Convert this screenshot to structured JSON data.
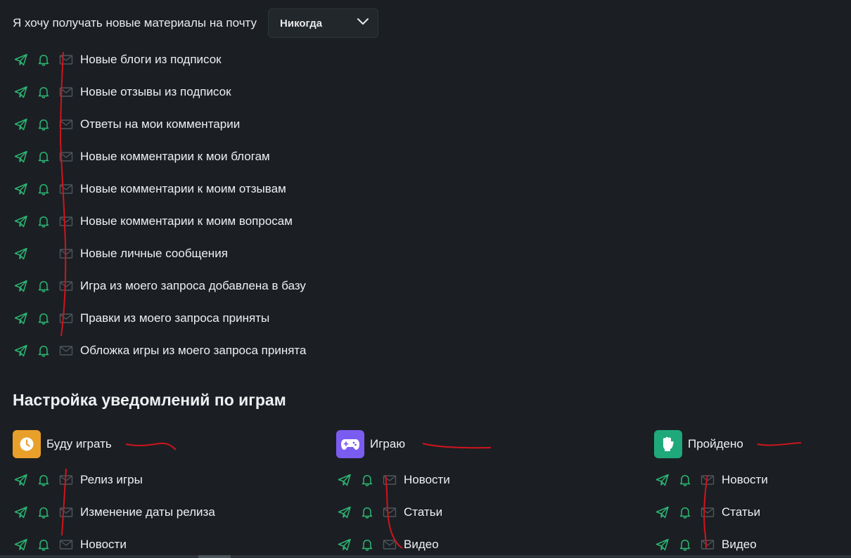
{
  "digest": {
    "label": "Я хочу получать новые материалы на почту",
    "selected": "Никогда"
  },
  "notifications": [
    {
      "label": "Новые блоги из подписок",
      "telegram": true,
      "bell": true,
      "email": true
    },
    {
      "label": "Новые отзывы из подписок",
      "telegram": true,
      "bell": true,
      "email": true
    },
    {
      "label": "Ответы на мои комментарии",
      "telegram": true,
      "bell": true,
      "email": true
    },
    {
      "label": "Новые комментарии к мои блогам",
      "telegram": true,
      "bell": true,
      "email": true
    },
    {
      "label": "Новые комментарии к моим отзывам",
      "telegram": true,
      "bell": true,
      "email": true
    },
    {
      "label": "Новые комментарии к моим вопросам",
      "telegram": true,
      "bell": true,
      "email": true
    },
    {
      "label": "Новые личные сообщения",
      "telegram": true,
      "bell": false,
      "email": true
    },
    {
      "label": "Игра из моего запроса добавлена в базу",
      "telegram": true,
      "bell": true,
      "email": true
    },
    {
      "label": "Правки из моего запроса приняты",
      "telegram": true,
      "bell": true,
      "email": true
    },
    {
      "label": "Обложка игры из моего запроса принята",
      "telegram": true,
      "bell": true,
      "email": true
    }
  ],
  "games_section": {
    "title": "Настройка уведомлений по играм",
    "categories": [
      {
        "title": "Буду играть",
        "icon": "clock-icon",
        "color": "#e8a02a",
        "items": [
          {
            "label": "Релиз игры"
          },
          {
            "label": "Изменение даты релиза"
          },
          {
            "label": "Новости"
          }
        ]
      },
      {
        "title": "Играю",
        "icon": "gamepad-icon",
        "color": "#7b5cf0",
        "items": [
          {
            "label": "Новости"
          },
          {
            "label": "Статьи"
          },
          {
            "label": "Видео"
          }
        ]
      },
      {
        "title": "Пройдено",
        "icon": "fist-icon",
        "color": "#1fa97a",
        "items": [
          {
            "label": "Новости"
          },
          {
            "label": "Статьи"
          },
          {
            "label": "Видео"
          }
        ]
      }
    ]
  },
  "colors": {
    "accent_green": "#2bb673",
    "muted_icon": "#4d565c",
    "annotation_red": "#d0141e"
  }
}
